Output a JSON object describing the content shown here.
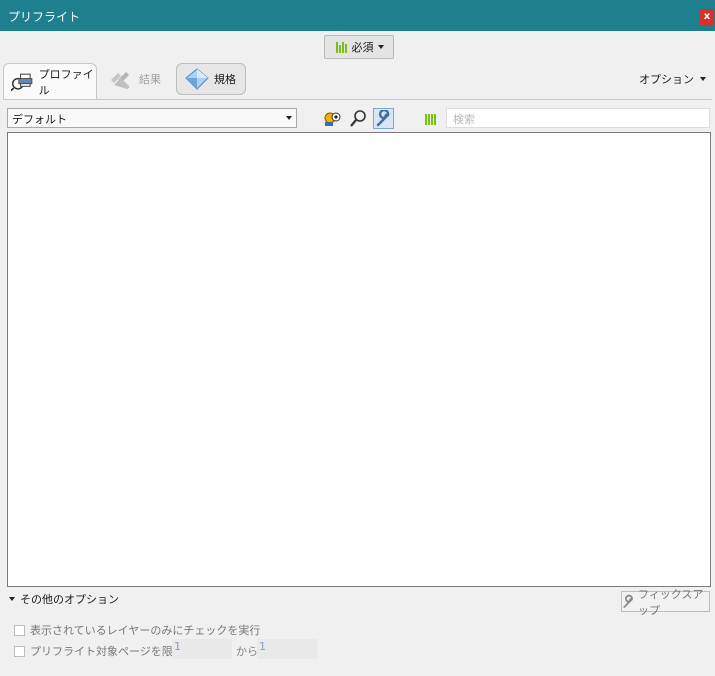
{
  "window": {
    "title": "プリフライト",
    "close_label": "x"
  },
  "topbar": {
    "required_label": "必須"
  },
  "tabs": [
    {
      "label": "プロファイル",
      "icon": "profile-icon"
    },
    {
      "label": "結果",
      "icon": "results-icon"
    },
    {
      "label": "規格",
      "icon": "standards-icon"
    }
  ],
  "options_menu": {
    "label": "オプション"
  },
  "profile_select": {
    "value": "デフォルト"
  },
  "search": {
    "placeholder": "検索"
  },
  "more_options": {
    "label": "その他のオプション",
    "fixup_label": "フィックスアップ",
    "visible_layers_label": "表示されているレイヤーのみにチェックを実行",
    "page_range_label": "プリフライト対象ページを限定 :",
    "from_value": "1",
    "range_sep": "から",
    "to_value": "1"
  },
  "colors": {
    "titlebar": "#1e7f8e",
    "close": "#d9302a",
    "accent_green": "#7abf17"
  }
}
